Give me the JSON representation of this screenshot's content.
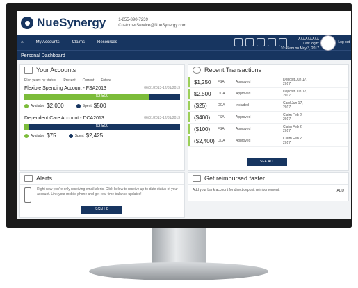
{
  "brand": {
    "name": "NueSynergy",
    "phone": "1-855-890-7239",
    "email": "CustomerService@NueSynergy.com"
  },
  "nav": {
    "items": [
      "My Accounts",
      "Claims",
      "Resources"
    ],
    "user_lines": [
      "XXXXXXXXX",
      "Last login:",
      "10:45am on May 3, 2017"
    ],
    "logout": "Log out"
  },
  "subbar": {
    "title": "Personal Dashboard"
  },
  "accounts": {
    "title": "Your Accounts",
    "filter_label": "Plan years by status:",
    "filters": [
      "Present",
      "Current",
      "Future"
    ],
    "fsa": {
      "name": "Flexible Spending Account - FSA2013",
      "dates": "06/01/2013-12/31/2013",
      "bar_label": "$2,500",
      "fill_fraction": 0.8,
      "available_label": "Available",
      "available": "$2,000",
      "spent_label": "Spent",
      "spent": "$500"
    },
    "dca": {
      "name": "Dependent Care Account - DCA2013",
      "dates": "06/01/2013-12/31/2013",
      "bar_label": "$2,500",
      "fill_fraction": 0.03,
      "available_label": "Available",
      "available": "$75",
      "spent_label": "Spent",
      "spent": "$2,425"
    }
  },
  "transactions": {
    "title": "Recent Transactions",
    "rows": [
      {
        "amount": "$1,250",
        "type": "FSA",
        "status": "Approved",
        "desc": "Deposit Jun 17, 2017"
      },
      {
        "amount": "$2,500",
        "type": "DCA",
        "status": "Approved",
        "desc": "Deposit Jun 17, 2017"
      },
      {
        "amount": "($25)",
        "type": "DCA",
        "status": "Included",
        "desc": "Card Jun 17, 2017"
      },
      {
        "amount": "($400)",
        "type": "FSA",
        "status": "Approved",
        "desc": "Claim Feb 2, 2017"
      },
      {
        "amount": "($100)",
        "type": "FSA",
        "status": "Approved",
        "desc": "Claim Feb 2, 2017"
      },
      {
        "amount": "($2,400)",
        "type": "DCA",
        "status": "Approved",
        "desc": "Claim Feb 2, 2017"
      }
    ],
    "see_all": "SEE ALL"
  },
  "alerts": {
    "title": "Alerts",
    "body": "Right now you're only receiving email alerts. Click below to receive up-to-date status of your account. Link your mobile phone and get real-time balance updates!",
    "signup": "SIGN UP"
  },
  "reimburse": {
    "title": "Get reimbursed faster",
    "body": "Add your bank account for direct deposit reimbursement.",
    "add": "ADD"
  },
  "colors": {
    "navy": "#173560",
    "green": "#7cbc3a"
  }
}
